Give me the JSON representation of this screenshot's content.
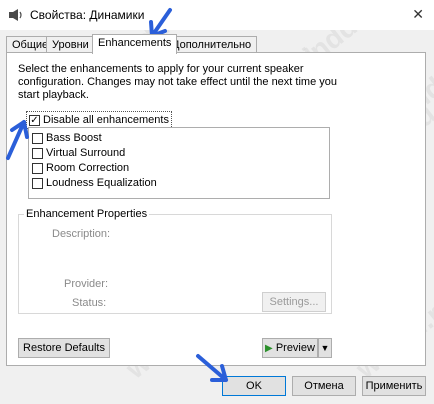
{
  "window": {
    "title": "Свойства: Динамики",
    "close_glyph": "✕"
  },
  "tabs": [
    {
      "label": "Общие"
    },
    {
      "label": "Уровни"
    },
    {
      "label": "Enhancements",
      "active": true
    },
    {
      "label": "Дополнительно"
    }
  ],
  "enhancements": {
    "description": "Select the enhancements to apply for your current speaker configuration. Changes may not take effect until the next time you start playback.",
    "disable_all_label": "Disable all enhancements",
    "disable_all_checked": true,
    "items": [
      {
        "label": "Bass Boost",
        "checked": false
      },
      {
        "label": "Virtual Surround",
        "checked": false
      },
      {
        "label": "Room Correction",
        "checked": false
      },
      {
        "label": "Loudness Equalization",
        "checked": false
      }
    ]
  },
  "properties": {
    "title": "Enhancement Properties",
    "description_label": "Description:",
    "provider_label": "Provider:",
    "status_label": "Status:",
    "settings_button": "Settings..."
  },
  "buttons": {
    "restore_defaults": "Restore Defaults",
    "preview": "Preview",
    "preview_dropdown": "▼",
    "ok": "OK",
    "cancel": "Отмена",
    "apply": "Применить"
  },
  "watermark": "windd.ru",
  "colors": {
    "annotation_arrow": "#2b5fd9",
    "focus_border": "#0078d7"
  }
}
